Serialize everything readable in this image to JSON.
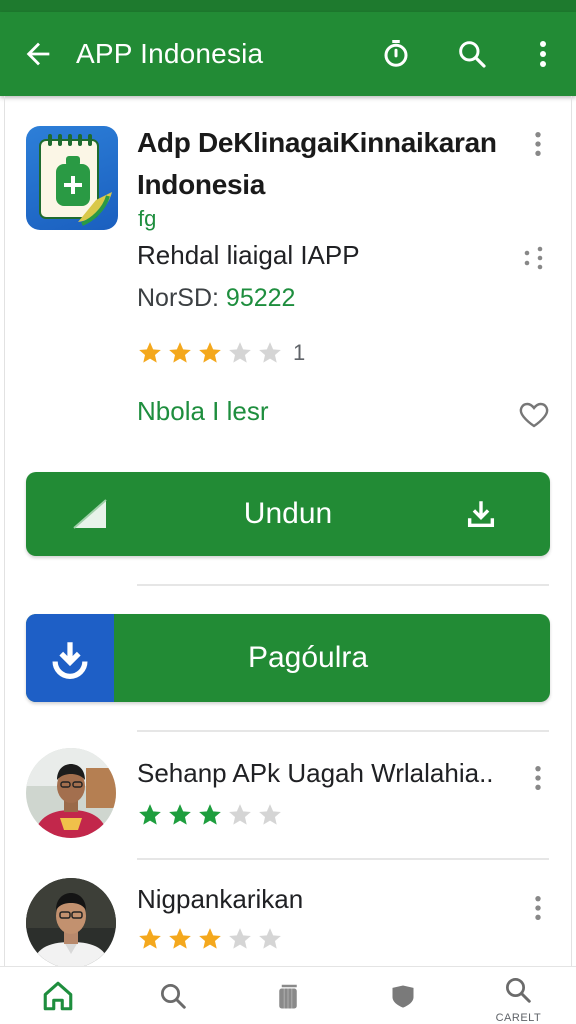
{
  "appbar": {
    "title": "APP Indonesia",
    "back_icon": "arrow-left-icon",
    "actions": [
      "timer-icon",
      "search-icon",
      "more-vert-icon"
    ]
  },
  "app": {
    "title": "Adp DeKlinagaiKinnaikaran Indonesia",
    "developer": "fg",
    "subtitle": "Rehdal liaigal IAPP",
    "version_label": "NorSD:",
    "version_value": "95222",
    "rating": 3,
    "rating_max": 5,
    "rating_count": "1",
    "category": "Nbola I lesr"
  },
  "buttons": {
    "download_label": "Undun",
    "secondary_label": "Pagóulra"
  },
  "reviews": [
    {
      "title": "Sehanp APk Uagah Wrlalahia..",
      "rating": 3,
      "rating_max": 5
    },
    {
      "title": "Nigpankarikan",
      "rating": 3,
      "rating_max": 5
    }
  ],
  "bottom_nav": [
    {
      "icon": "home-icon",
      "label": ""
    },
    {
      "icon": "search-icon",
      "label": ""
    },
    {
      "icon": "library-icon",
      "label": ""
    },
    {
      "icon": "shield-icon",
      "label": ""
    },
    {
      "icon": "search-icon",
      "label": "CARELT"
    }
  ],
  "colors": {
    "primary": "#228b35",
    "accent_blue": "#1e5fc6",
    "star": "#f4a81d",
    "star_green": "#1e9e3e",
    "star_empty": "#d5d5d5",
    "link_green": "#1e8e3e"
  }
}
